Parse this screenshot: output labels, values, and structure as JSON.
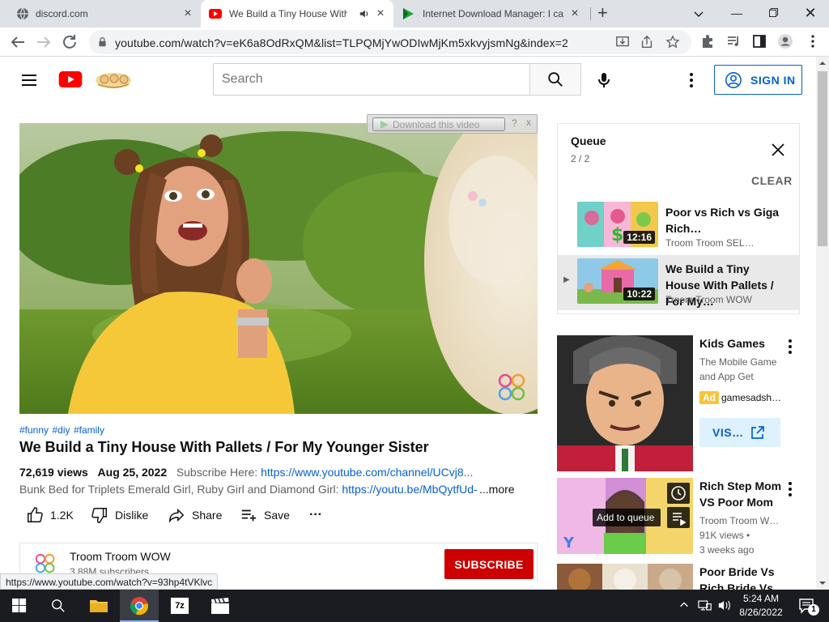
{
  "browser": {
    "tabs": [
      {
        "title": "discord.com",
        "active": false
      },
      {
        "title": "We Build a Tiny House With",
        "active": true
      },
      {
        "title": "Internet Download Manager: I ca",
        "active": false
      }
    ],
    "new_tab_glyph": "+",
    "url": "youtube.com/watch?v=eK6a8OdRxQM&list=TLPQMjYwODIwMjKm5xkvyjsmNg&index=2"
  },
  "header": {
    "search_placeholder": "Search",
    "signin_label": "SIGN IN"
  },
  "idm": {
    "download_label": "Download this video",
    "help_glyph": "?",
    "close_glyph": "x"
  },
  "video": {
    "hashtags": [
      "#funny",
      "#diy",
      "#family"
    ],
    "title": "We Build a Tiny House With Pallets / For My Younger Sister",
    "views": "72,619 views",
    "date": "Aug 25, 2022",
    "subscribe_here": "Subscribe Here:",
    "subscribe_link": "https://www.youtube.com/channel/UCvj8...",
    "desc_text": "Bunk Bed for Triplets Emerald Girl, Ruby Girl and Diamond Girl:",
    "desc_link": "https://youtu.be/MbQytfUd-",
    "more_label": "...more",
    "actions": {
      "likes": "1.2K",
      "dislike": "Dislike",
      "share": "Share",
      "save": "Save",
      "more_glyph": "···"
    },
    "channel": {
      "name": "Troom Troom WOW",
      "subscribers": "3.88M subscribers",
      "subscribe_label": "SUBSCRIBE"
    }
  },
  "status_bar_url": "https://www.youtube.com/watch?v=93hp4tVKlvc",
  "queue": {
    "title": "Queue",
    "position": "2 / 2",
    "clear_label": "CLEAR",
    "items": [
      {
        "title": "Poor vs Rich vs Giga Rich…",
        "channel": "Troom Troom SEL…",
        "duration": "12:16"
      },
      {
        "title": "We Build a Tiny House With Pallets / For My…",
        "channel": "Troom Troom WOW",
        "duration": "10:22",
        "playing_glyph": "▶"
      }
    ]
  },
  "ad": {
    "title": "Kids Games",
    "line1": "The Mobile Game",
    "line2": "and App Get",
    "badge": "Ad",
    "domain": "gamesadsh…",
    "visit_label": "VIS…"
  },
  "recommendations": [
    {
      "title_line1": "Rich Step Mom",
      "title_line2": "VS Poor Mom",
      "channel": "Troom Troom W…",
      "views": "91K views •",
      "age": "3 weeks ago",
      "hover_label": "Add to queue"
    },
    {
      "title_line1": "Poor Bride Vs",
      "title_line2": "Rich Bride Vs"
    }
  ],
  "taskbar": {
    "time": "5:24 AM",
    "date": "8/26/2022",
    "notifications": "1"
  },
  "colors": {
    "youtube_red": "#ff0000",
    "link_blue": "#065fd4",
    "subscribe_red": "#cc0000",
    "taskbar": "#1a1c22"
  }
}
